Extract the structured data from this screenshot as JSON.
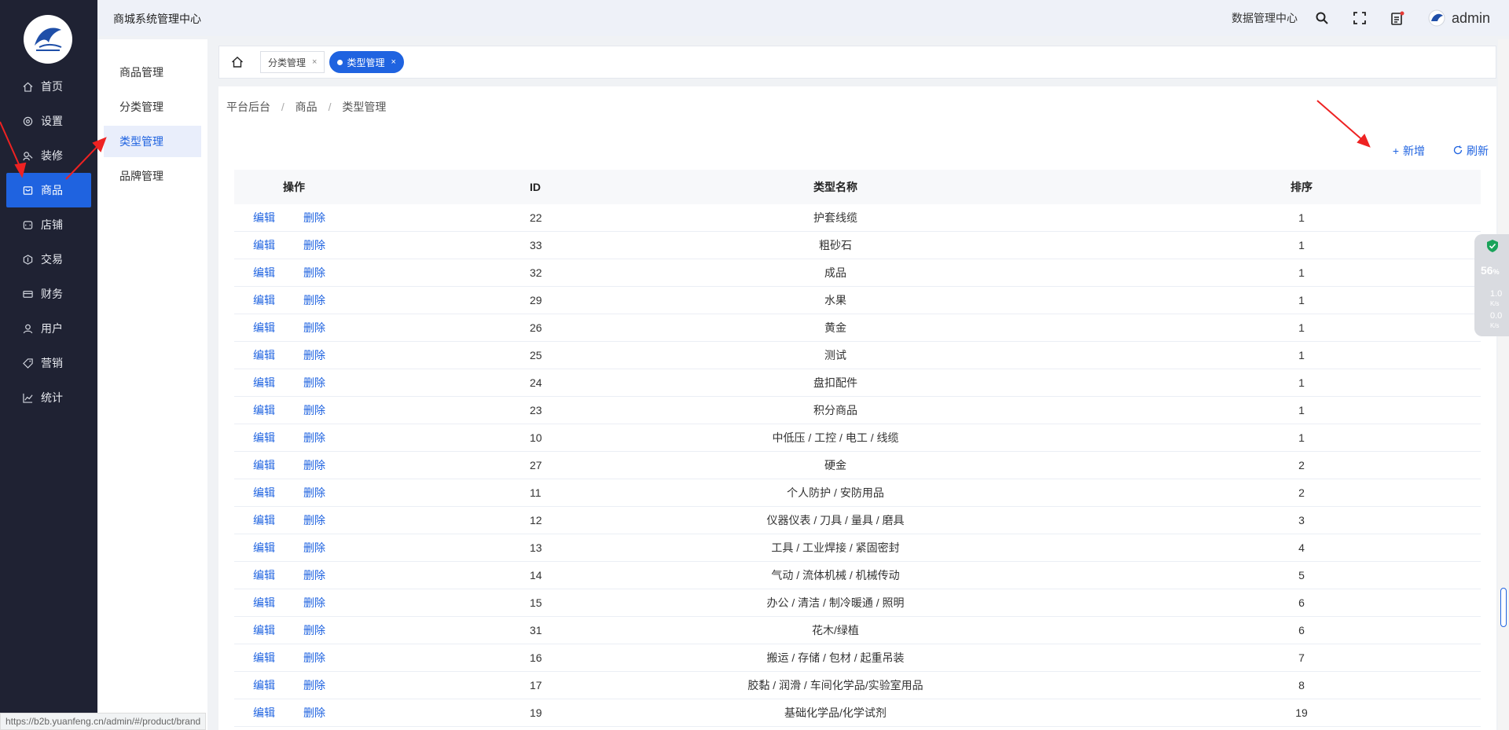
{
  "header": {
    "system_title": "商城系统管理中心",
    "data_center_link": "数据管理中心",
    "user_name": "admin",
    "icons": [
      "search-icon",
      "fullscreen-icon",
      "notice-icon",
      "avatar-icon"
    ]
  },
  "sidebar": {
    "items": [
      {
        "label": "首页",
        "icon": "home-icon"
      },
      {
        "label": "设置",
        "icon": "settings-icon"
      },
      {
        "label": "装修",
        "icon": "decorate-icon"
      },
      {
        "label": "商品",
        "icon": "goods-icon",
        "active": true
      },
      {
        "label": "店铺",
        "icon": "store-icon"
      },
      {
        "label": "交易",
        "icon": "trade-icon"
      },
      {
        "label": "财务",
        "icon": "finance-icon"
      },
      {
        "label": "用户",
        "icon": "user-icon"
      },
      {
        "label": "营销",
        "icon": "marketing-icon"
      },
      {
        "label": "统计",
        "icon": "stats-icon"
      }
    ]
  },
  "submenu": {
    "items": [
      {
        "label": "商品管理"
      },
      {
        "label": "分类管理"
      },
      {
        "label": "类型管理",
        "active": true
      },
      {
        "label": "品牌管理"
      }
    ]
  },
  "tabs": {
    "items": [
      {
        "label": "分类管理",
        "close": "×"
      },
      {
        "label": "类型管理",
        "close": "×",
        "active": true
      }
    ]
  },
  "breadcrumb": [
    "平台后台",
    "商品",
    "类型管理"
  ],
  "breadcrumb_sep": "/",
  "toolbar": {
    "add_label": "新增",
    "refresh_label": "刷新"
  },
  "table": {
    "columns": {
      "op": "操作",
      "id": "ID",
      "name": "类型名称",
      "sort": "排序"
    },
    "edit_label": "编辑",
    "delete_label": "删除",
    "rows": [
      {
        "id": "22",
        "name": "护套线缆",
        "sort": "1"
      },
      {
        "id": "33",
        "name": "粗砂石",
        "sort": "1"
      },
      {
        "id": "32",
        "name": "成品",
        "sort": "1"
      },
      {
        "id": "29",
        "name": "水果",
        "sort": "1"
      },
      {
        "id": "26",
        "name": "黄金",
        "sort": "1"
      },
      {
        "id": "25",
        "name": "测试",
        "sort": "1"
      },
      {
        "id": "24",
        "name": "盘扣配件",
        "sort": "1"
      },
      {
        "id": "23",
        "name": "积分商品",
        "sort": "1"
      },
      {
        "id": "10",
        "name": "中低压 / 工控 / 电工 / 线缆",
        "sort": "1"
      },
      {
        "id": "27",
        "name": "硬金",
        "sort": "2"
      },
      {
        "id": "11",
        "name": "个人防护 / 安防用品",
        "sort": "2"
      },
      {
        "id": "12",
        "name": "仪器仪表 / 刀具 / 量具 / 磨具",
        "sort": "3"
      },
      {
        "id": "13",
        "name": "工具 / 工业焊接 / 紧固密封",
        "sort": "4"
      },
      {
        "id": "14",
        "name": "气动 / 流体机械 / 机械传动",
        "sort": "5"
      },
      {
        "id": "15",
        "name": "办公 / 清洁 / 制冷暖通 / 照明",
        "sort": "6"
      },
      {
        "id": "31",
        "name": "花木/绿植",
        "sort": "6"
      },
      {
        "id": "16",
        "name": "搬运 / 存储 / 包材 / 起重吊装",
        "sort": "7"
      },
      {
        "id": "17",
        "name": "胶黏 / 润滑 / 车间化学品/实验室用品",
        "sort": "8"
      },
      {
        "id": "19",
        "name": "基础化学品/化学试剂",
        "sort": "19"
      }
    ]
  },
  "status_url": "https://b2b.yuanfeng.cn/admin/#/product/brand",
  "widget": {
    "percent": "56",
    "percent_unit": "%",
    "up_speed": "1.0",
    "down_speed": "0.0",
    "speed_unit": "K/s"
  },
  "colors": {
    "accent": "#1f63e0",
    "sidebar_bg": "#1f2233",
    "annotation": "#ee2222"
  }
}
